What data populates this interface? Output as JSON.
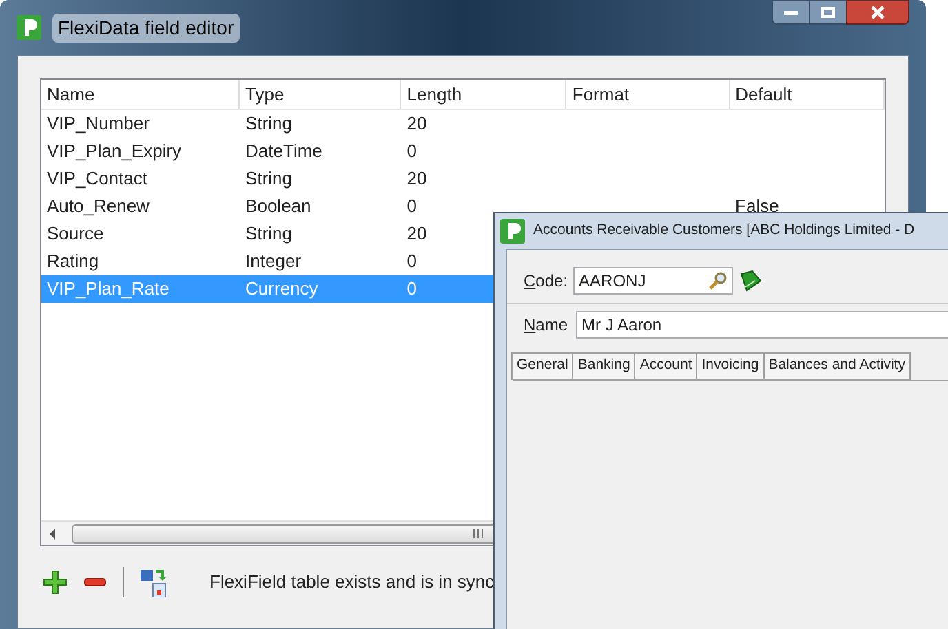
{
  "window": {
    "title": "FlexiData field editor"
  },
  "table": {
    "columns": [
      "Name",
      "Type",
      "Length",
      "Format",
      "Default"
    ],
    "rows": [
      {
        "cells": [
          "VIP_Number",
          "String",
          "20",
          "",
          ""
        ],
        "selected": false
      },
      {
        "cells": [
          "VIP_Plan_Expiry",
          "DateTime",
          "0",
          "",
          ""
        ],
        "selected": false
      },
      {
        "cells": [
          "VIP_Contact",
          "String",
          "20",
          "",
          ""
        ],
        "selected": false
      },
      {
        "cells": [
          "Auto_Renew",
          "Boolean",
          "0",
          "",
          "False"
        ],
        "selected": false
      },
      {
        "cells": [
          "Source",
          "String",
          "20",
          "",
          ""
        ],
        "selected": false
      },
      {
        "cells": [
          "Rating",
          "Integer",
          "0",
          "",
          ""
        ],
        "selected": false
      },
      {
        "cells": [
          "VIP_Plan_Rate",
          "Currency",
          "0",
          "",
          ""
        ],
        "selected": true
      }
    ]
  },
  "status": "FlexiField table exists and is in sync",
  "customer_window": {
    "title": "Accounts Receivable Customers [ABC Holdings Limited - D",
    "code_label": "Code:",
    "code_value": "AARONJ",
    "name_label": "Name",
    "name_value": "Mr J Aaron",
    "tabs": [
      "General",
      "Banking",
      "Account",
      "Invoicing",
      "Balances and Activity"
    ]
  }
}
